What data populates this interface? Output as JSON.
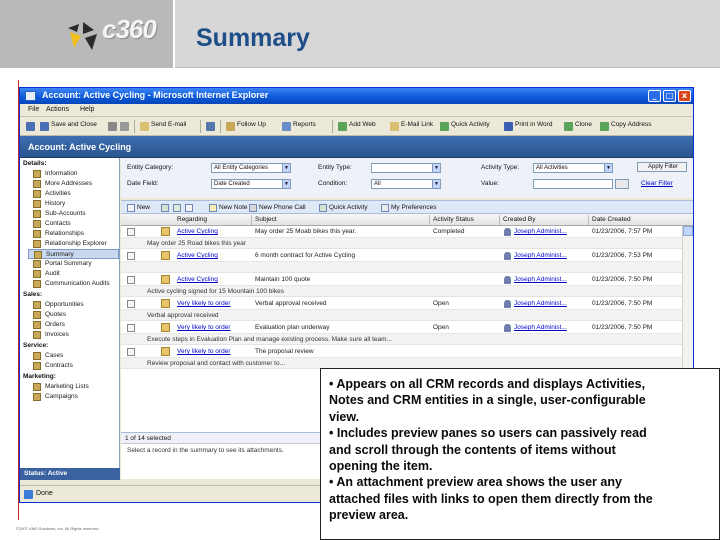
{
  "slide": {
    "title": "Summary",
    "logo_text": "c360",
    "copyright": "©2007 c360 Solutions, Inc. All Rights reserved."
  },
  "window": {
    "title": "Account: Active Cycling - Microsoft Internet Explorer",
    "menu": [
      "File",
      "Actions",
      "Help"
    ],
    "toolbar": [
      "Save and Close",
      "Send E-mail",
      "Follow Up",
      "Reports",
      "Add Web",
      "E-Mail Link",
      "Quick Activity",
      "Print in Word",
      "Clone",
      "Copy Address"
    ],
    "status": "Done",
    "controls": [
      "_",
      "□",
      "x"
    ]
  },
  "app": {
    "header": "Account: Active Cycling",
    "status_label": "Status: Active"
  },
  "nav": {
    "sections": [
      {
        "label": "Details:",
        "items": [
          "Information",
          "More Addresses",
          "Activities",
          "History",
          "Sub-Accounts",
          "Contacts",
          "Relationships",
          "Relationship Explorer",
          "Summary",
          "Portal Summary",
          "Audit",
          "Communication Audits"
        ]
      },
      {
        "label": "Sales:",
        "items": [
          "Opportunities",
          "Quotes",
          "Orders",
          "Invoices"
        ]
      },
      {
        "label": "Service:",
        "items": [
          "Cases",
          "Contracts"
        ]
      },
      {
        "label": "Marketing:",
        "items": [
          "Marketing Lists",
          "Campaigns"
        ]
      }
    ],
    "selected": "Summary"
  },
  "filter": {
    "entity_category_label": "Entity Category:",
    "entity_category_value": "All Entity Categories",
    "entity_type_label": "Entity Type:",
    "entity_type_value": "",
    "activity_type_label": "Activity Type:",
    "activity_type_value": "All Activities",
    "apply_label": "Apply Filter",
    "date_field_label": "Date Field:",
    "date_field_value": "Date Created",
    "condition_label": "Condition:",
    "condition_value": "All",
    "value_label": "Value:",
    "value_value": "",
    "clear_label": "Clear Filter"
  },
  "grid_toolbar": [
    "New",
    "New Note",
    "New Phone Call",
    "Quick Activity",
    "My Preferences"
  ],
  "columns": [
    "Regarding",
    "Subject",
    "Activity Status",
    "Created By",
    "Date Created"
  ],
  "rows": [
    {
      "regarding": "Active Cycling",
      "subject": "May order 25 Moab bikes this year.",
      "status": "Completed",
      "created_by": "Joseph Administ...",
      "date": "01/23/2006, 7:57 PM",
      "preview": "May order 25 Road bikes this year"
    },
    {
      "regarding": "Active Cycling",
      "subject": "6 month contract for Active Cycling",
      "status": "",
      "created_by": "Joseph Administ...",
      "date": "01/23/2006, 7:53 PM",
      "preview": ""
    },
    {
      "regarding": "Active Cycling",
      "subject": "Maintain 100 quote",
      "status": "",
      "created_by": "Joseph Administ...",
      "date": "01/23/2006, 7:50 PM",
      "preview": "Active cycling signed for 15 Mountain 100 bikes"
    },
    {
      "regarding": "Very likely to order",
      "subject": "Verbal approval received",
      "status": "Open",
      "created_by": "Joseph Administ...",
      "date": "01/23/2006, 7:50 PM",
      "preview": "Verbal approval received"
    },
    {
      "regarding": "Very likely to order",
      "subject": "Evaluation plan underway",
      "status": "Open",
      "created_by": "Joseph Administ...",
      "date": "01/23/2006, 7:50 PM",
      "preview": "Execute steps in Evaluation Plan and manage existing process. Make sure all team..."
    },
    {
      "regarding": "Very likely to order",
      "subject": "The proposal review",
      "status": "",
      "created_by": "",
      "date": "",
      "preview": "Review proposal and contact with customer to..."
    }
  ],
  "grid_footer": "1 of 14 selected",
  "attachment_hint": "Select a record in the summary to see its attachments.",
  "callout": {
    "lines": [
      "• Appears on all CRM records and displays Activities,",
      "Notes and CRM entities in a single, user-configurable",
      "view.",
      "• Includes preview panes so users can passively read",
      "and scroll through the contents of items without",
      "opening the item.",
      "• An attachment preview area shows the user any",
      "attached files with links to open them directly from the",
      "preview area."
    ]
  },
  "colors": {
    "title_blue": "#1d4e87",
    "xp_title_blue": "#0a57d8",
    "crm_header_blue": "#3e6fb0"
  }
}
